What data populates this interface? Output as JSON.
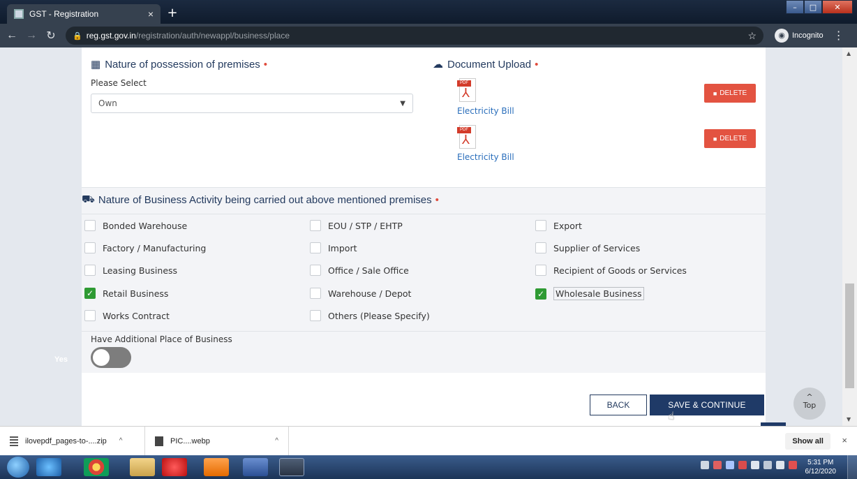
{
  "browser": {
    "tab_title": "GST - Registration",
    "tab_close": "×",
    "new_tab": "+",
    "url_host": "reg.gst.gov.in",
    "url_path": "/registration/auth/newappl/business/place",
    "incognito_label": "Incognito"
  },
  "possession": {
    "heading": "Nature of possession of premises",
    "select_label": "Please Select",
    "select_value": "Own"
  },
  "upload": {
    "heading": "Document Upload",
    "pdf_tag": "PDF",
    "documents": [
      {
        "name": "Electricity Bill",
        "delete_label": "DELETE"
      },
      {
        "name": "Electricity Bill",
        "delete_label": "DELETE"
      }
    ]
  },
  "required_marker": "•",
  "activity": {
    "heading": "Nature of Business Activity being carried out above mentioned premises",
    "options": [
      {
        "label": "Bonded Warehouse",
        "checked": false
      },
      {
        "label": "EOU / STP / EHTP",
        "checked": false
      },
      {
        "label": "Export",
        "checked": false
      },
      {
        "label": "Factory / Manufacturing",
        "checked": false
      },
      {
        "label": "Import",
        "checked": false
      },
      {
        "label": "Supplier of Services",
        "checked": false
      },
      {
        "label": "Leasing Business",
        "checked": false
      },
      {
        "label": "Office / Sale Office",
        "checked": false
      },
      {
        "label": "Recipient of Goods or Services",
        "checked": false
      },
      {
        "label": "Retail Business",
        "checked": true
      },
      {
        "label": "Warehouse / Depot",
        "checked": false
      },
      {
        "label": "Wholesale Business",
        "checked": true
      },
      {
        "label": "Works Contract",
        "checked": false
      },
      {
        "label": "Others (Please Specify)",
        "checked": false
      }
    ]
  },
  "additional": {
    "label": "Have Additional Place of Business",
    "toggle_on": false,
    "faint_text": "Yes"
  },
  "actions": {
    "back": "BACK",
    "save": "SAVE & CONTINUE",
    "top_label": "Top",
    "top_arrow": "^"
  },
  "downloads": {
    "items": [
      "ilovepdf_pages-to-....zip",
      "PIC....webp"
    ],
    "show_all": "Show all",
    "close": "×"
  },
  "taskbar": {
    "time": "5:31 PM",
    "date": "6/12/2020"
  },
  "colors": {
    "primary": "#1f3a67",
    "danger": "#e35341",
    "check": "#2e9a33",
    "required": "#e04b3c"
  }
}
